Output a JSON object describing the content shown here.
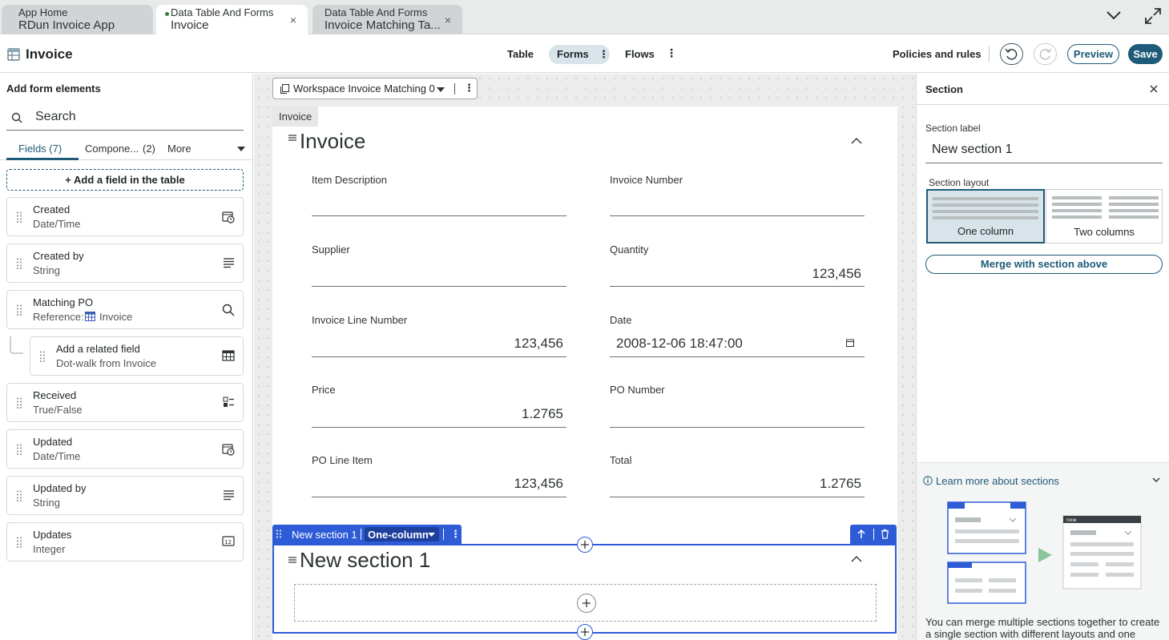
{
  "tabs": [
    {
      "line1": "App Home",
      "line2": "RDun Invoice App"
    },
    {
      "line1": "Data Table And Forms",
      "line2": "Invoice",
      "close": "×"
    },
    {
      "line1": "Data Table And Forms",
      "line2": "Invoice Matching Ta...",
      "close": "×"
    }
  ],
  "header": {
    "title": "Invoice",
    "nav": {
      "table": "Table",
      "forms": "Forms",
      "flows": "Flows"
    },
    "kebab": "⋮",
    "policies": "Policies and rules",
    "preview": "Preview",
    "save": "Save"
  },
  "left": {
    "title": "Add form elements",
    "search_placeholder": "Search",
    "tabs": {
      "fields": "Fields (7)",
      "components": "Compone...",
      "components_count": "(2)",
      "more": "More"
    },
    "add_field": "+ Add a field in the table",
    "fields": [
      {
        "name": "Created",
        "type": "Date/Time",
        "icon": "calendar-clock-icon"
      },
      {
        "name": "Created by",
        "type": "String",
        "icon": "text-lines-icon"
      },
      {
        "name": "Matching PO",
        "type": "Reference:",
        "ref": "Invoice",
        "icon": "search-icon"
      },
      {
        "name": "Add a related field",
        "type": "Dot-walk from Invoice",
        "icon": "table-icon"
      },
      {
        "name": "Received",
        "type": "True/False",
        "icon": "toggle-list-icon"
      },
      {
        "name": "Updated",
        "type": "Date/Time",
        "icon": "calendar-clock-icon"
      },
      {
        "name": "Updated by",
        "type": "String",
        "icon": "text-lines-icon"
      },
      {
        "name": "Updates",
        "type": "Integer",
        "icon": "integer-icon"
      }
    ]
  },
  "canvas": {
    "workspace": "Workspace Invoice Matching 0",
    "form_tag": "Invoice",
    "section_title": "Invoice",
    "fields": [
      {
        "label": "Item Description",
        "value": ""
      },
      {
        "label": "Invoice Number",
        "value": ""
      },
      {
        "label": "Supplier",
        "value": ""
      },
      {
        "label": "Quantity",
        "value": "123,456"
      },
      {
        "label": "Invoice Line Number",
        "value": "123,456"
      },
      {
        "label": "Date",
        "value": "2008-12-06 18:47:00"
      },
      {
        "label": "Price",
        "value": "1.2765"
      },
      {
        "label": "PO Number",
        "value": ""
      },
      {
        "label": "PO Line Item",
        "value": "123,456"
      },
      {
        "label": "Total",
        "value": "1.2765"
      }
    ],
    "new_section": {
      "bar_label": "New section 1",
      "layout": "One-column",
      "title": "New section 1"
    }
  },
  "right": {
    "title": "Section",
    "label_caption": "Section label",
    "label_value": "New section 1",
    "layout_caption": "Section layout",
    "one_column": "One column",
    "two_columns": "Two columns",
    "merge": "Merge with section above",
    "learn_more": "Learn more about sections",
    "illustration_brand": "now",
    "description": "You can merge multiple sections together to create a single section with different layouts and one section"
  },
  "colors": {
    "accent": "#1e5b78",
    "section_blue": "#2d5cd6",
    "selected_bg": "#d9e4ea",
    "green": "#8bc49a"
  }
}
